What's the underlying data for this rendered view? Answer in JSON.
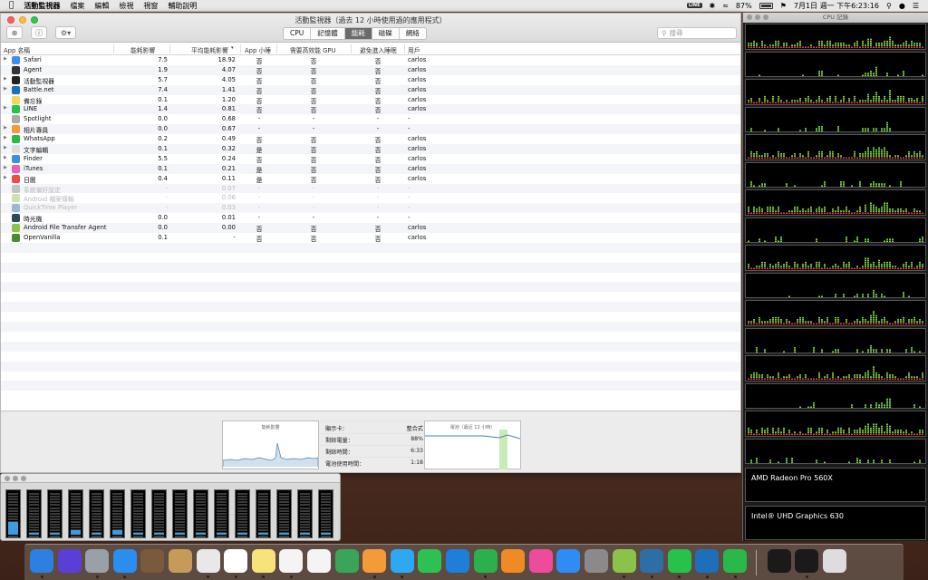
{
  "menubar": {
    "app": "活動監視器",
    "items": [
      "檔案",
      "編輯",
      "檢視",
      "視窗",
      "輔助說明"
    ],
    "battery_pct": "87%",
    "clock": "7月1日 週一 下午6:23:16"
  },
  "window": {
    "title": "活動監視器（過去 12 小時使用過的應用程式）",
    "tabs": [
      "CPU",
      "記憶體",
      "能耗",
      "磁碟",
      "網絡"
    ],
    "active_tab": 2,
    "search_placeholder": "搜尋"
  },
  "table": {
    "headers": [
      "App 名稱",
      "能耗影響",
      "平均能耗影響",
      "App 小睡",
      "需要高效能 GPU",
      "避免進入睡眠",
      "用戶"
    ],
    "rows": [
      {
        "name": "Safari",
        "icon": "safari",
        "impact": "7.5",
        "avg": "18.92",
        "nap": "否",
        "gpu": "否",
        "sleep": "否",
        "user": "carlos",
        "expand": true,
        "dim": false
      },
      {
        "name": "Agent",
        "icon": "agent",
        "impact": "1.9",
        "avg": "4.07",
        "nap": "否",
        "gpu": "否",
        "sleep": "否",
        "user": "carlos",
        "expand": false,
        "dim": false
      },
      {
        "name": "活動監視器",
        "icon": "activity",
        "impact": "5.7",
        "avg": "4.05",
        "nap": "否",
        "gpu": "否",
        "sleep": "否",
        "user": "carlos",
        "expand": true,
        "dim": false
      },
      {
        "name": "Battle.net",
        "icon": "battlenet",
        "impact": "7.4",
        "avg": "1.41",
        "nap": "否",
        "gpu": "否",
        "sleep": "否",
        "user": "carlos",
        "expand": true,
        "dim": false
      },
      {
        "name": "備忘錄",
        "icon": "notes",
        "impact": "0.1",
        "avg": "1.20",
        "nap": "否",
        "gpu": "否",
        "sleep": "否",
        "user": "carlos",
        "expand": false,
        "dim": false
      },
      {
        "name": "LINE",
        "icon": "line",
        "impact": "1.4",
        "avg": "0.81",
        "nap": "否",
        "gpu": "否",
        "sleep": "否",
        "user": "carlos",
        "expand": true,
        "dim": false
      },
      {
        "name": "Spotlight",
        "icon": "spotlight",
        "impact": "0.0",
        "avg": "0.68",
        "nap": "-",
        "gpu": "-",
        "sleep": "-",
        "user": "-",
        "expand": false,
        "dim": false
      },
      {
        "name": "相片專員",
        "icon": "photos",
        "impact": "0.0",
        "avg": "0.67",
        "nap": "-",
        "gpu": "-",
        "sleep": "-",
        "user": "-",
        "expand": true,
        "dim": false
      },
      {
        "name": "WhatsApp",
        "icon": "whatsapp",
        "impact": "0.2",
        "avg": "0.49",
        "nap": "否",
        "gpu": "否",
        "sleep": "否",
        "user": "carlos",
        "expand": true,
        "dim": false
      },
      {
        "name": "文字編輯",
        "icon": "textedit",
        "impact": "0.1",
        "avg": "0.32",
        "nap": "是",
        "gpu": "否",
        "sleep": "否",
        "user": "carlos",
        "expand": true,
        "dim": false
      },
      {
        "name": "Finder",
        "icon": "finder",
        "impact": "5.5",
        "avg": "0.24",
        "nap": "否",
        "gpu": "否",
        "sleep": "否",
        "user": "carlos",
        "expand": true,
        "dim": false
      },
      {
        "name": "iTunes",
        "icon": "itunes",
        "impact": "0.1",
        "avg": "0.21",
        "nap": "是",
        "gpu": "否",
        "sleep": "否",
        "user": "carlos",
        "expand": true,
        "dim": false
      },
      {
        "name": "日曆",
        "icon": "calendar",
        "impact": "0.4",
        "avg": "0.11",
        "nap": "是",
        "gpu": "否",
        "sleep": "否",
        "user": "carlos",
        "expand": true,
        "dim": false
      },
      {
        "name": "系統偏好設定",
        "icon": "prefs",
        "impact": "-",
        "avg": "0.07",
        "nap": "-",
        "gpu": "-",
        "sleep": "-",
        "user": "-",
        "expand": false,
        "dim": true
      },
      {
        "name": "Android 檔案傳輸",
        "icon": "android",
        "impact": "-",
        "avg": "0.06",
        "nap": "-",
        "gpu": "-",
        "sleep": "-",
        "user": "-",
        "expand": false,
        "dim": true
      },
      {
        "name": "QuickTime Player",
        "icon": "quicktime",
        "impact": "-",
        "avg": "0.03",
        "nap": "-",
        "gpu": "-",
        "sleep": "-",
        "user": "-",
        "expand": false,
        "dim": true
      },
      {
        "name": "時光機",
        "icon": "timemachine",
        "impact": "0.0",
        "avg": "0.01",
        "nap": "-",
        "gpu": "-",
        "sleep": "-",
        "user": "-",
        "expand": false,
        "dim": false
      },
      {
        "name": "Android File Transfer Agent",
        "icon": "android",
        "impact": "0.0",
        "avg": "0.00",
        "nap": "否",
        "gpu": "否",
        "sleep": "否",
        "user": "carlos",
        "expand": false,
        "dim": false
      },
      {
        "name": "OpenVanilla",
        "icon": "openvanilla",
        "impact": "0.1",
        "avg": "-",
        "nap": "否",
        "gpu": "否",
        "sleep": "否",
        "user": "carlos",
        "expand": false,
        "dim": false
      }
    ]
  },
  "bottom": {
    "energy_title": "能耗影響",
    "graphics_label": "顯示卡：",
    "graphics_value": "整合式",
    "remaining_charge_label": "剩餘電量：",
    "remaining_charge_value": "88%",
    "time_remaining_label": "剩餘時間：",
    "time_remaining_value": "6:33",
    "time_on_battery_label": "電池使用時間：",
    "time_on_battery_value": "1:18",
    "battery_title": "電池（最近 12 小時）"
  },
  "cpu_history": {
    "title": "CPU 記錄",
    "gpus": [
      "AMD Radeon Pro 560X",
      "Intel® UHD Graphics 630"
    ]
  },
  "cpu_usage_levels": [
    0.3,
    0.05,
    0.05,
    0.1,
    0.05,
    0.1,
    0.05,
    0.05,
    0.05,
    0.05,
    0.05,
    0.05,
    0.05,
    0.05,
    0.05,
    0.05
  ],
  "dock": {
    "apps": [
      "Finder",
      "Siri",
      "Launchpad",
      "Safari",
      "Preview",
      "Notebooks",
      "Chrome",
      "日曆",
      "備忘錄",
      "文字編輯",
      "提醒事項",
      "地圖",
      "相片",
      "訊息",
      "FaceTime",
      "Keynote",
      "Numbers",
      "Pages",
      "iTunes",
      "App Store",
      "系統偏好設定",
      "Android",
      "QuickTime",
      "LINE",
      "Battle.net",
      "WhatsApp",
      "Xcode",
      "活動監視器",
      "垃圾桶"
    ]
  },
  "colors": {
    "accent": "#6b6b6b",
    "graph_green": "#7ad43c",
    "graph_red": "#e0413d"
  }
}
